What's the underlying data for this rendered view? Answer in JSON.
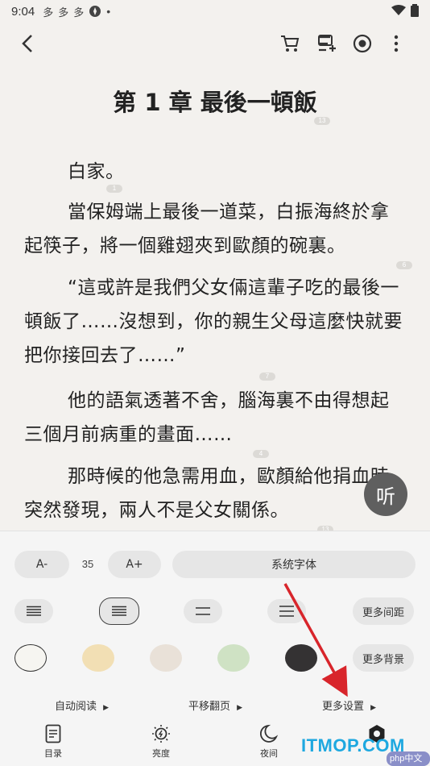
{
  "status_bar": {
    "time": "9:04",
    "notifications": [
      "多",
      "多",
      "多"
    ]
  },
  "reader": {
    "chapter_title": "第 1 章 最後一頓飯",
    "title_badge": "13",
    "paragraphs": [
      {
        "text": "白家。",
        "badge": "1"
      },
      {
        "text": "當保姆端上最後一道菜，白振海終於拿起筷子，將一個雞翅夾到歐顏的碗裏。",
        "badge": "6"
      },
      {
        "text": "“這或許是我們父女倆這輩子吃的最後一頓飯了……沒想到，你的親生父母這麼快就要把你接回去了……”",
        "badge": "7"
      },
      {
        "text": "他的語氣透著不舍，腦海裏不由得想起三個月前病重的畫面……",
        "badge": "4"
      },
      {
        "text": "那時候的他急需用血，歐顏給他捐血時突然發現，兩人不是父女關係。",
        "badge": "13"
      }
    ],
    "listen_label": "听"
  },
  "settings_panel": {
    "font_decrease": "A-",
    "font_size": "35",
    "font_increase": "A+",
    "font_family": "系统字体",
    "more_spacing": "更多间距",
    "more_background": "更多背景",
    "background_colors": [
      "#f6f5f1",
      "#f2dfb4",
      "#e9e1d8",
      "#cfe2c4",
      "#343233"
    ],
    "auto_read": "自动阅读",
    "page_turn": "平移翻页",
    "more_settings": "更多设置"
  },
  "bottom_nav": [
    {
      "label": "目录",
      "icon": "table-of-contents-icon"
    },
    {
      "label": "亮度",
      "icon": "brightness-icon"
    },
    {
      "label": "夜间",
      "icon": "night-mode-icon"
    },
    {
      "label": "设置",
      "icon": "settings-icon"
    }
  ],
  "watermark": {
    "text": "ITMOP.COM",
    "badge": "php中文网"
  },
  "annotation_color": "#d8252b"
}
